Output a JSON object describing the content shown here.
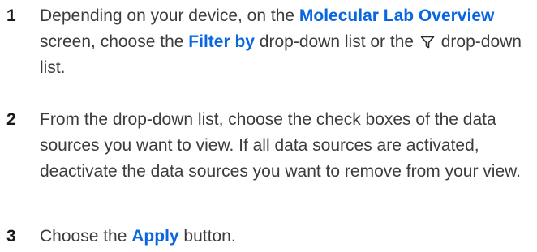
{
  "steps": [
    {
      "number": "1",
      "parts": {
        "t1": "Depending on your device, on the ",
        "b1": "Molecular Lab Overview",
        "t2": " screen, choose the ",
        "b2": "Filter by",
        "t3": " drop-down list or the ",
        "icon": "filter-funnel-icon",
        "t4": " drop-down list."
      }
    },
    {
      "number": "2",
      "text": "From the drop-down list, choose the check boxes of the data sources you want to view. If all data sources are activated, deactivate the data sources you want to remove from your view."
    },
    {
      "number": "3",
      "parts": {
        "t1": "Choose the ",
        "b1": "Apply",
        "t2": " button."
      }
    }
  ],
  "colors": {
    "text": "#3c3c3c",
    "number": "#1a1a1a",
    "ui_term": "#0a66e0"
  }
}
